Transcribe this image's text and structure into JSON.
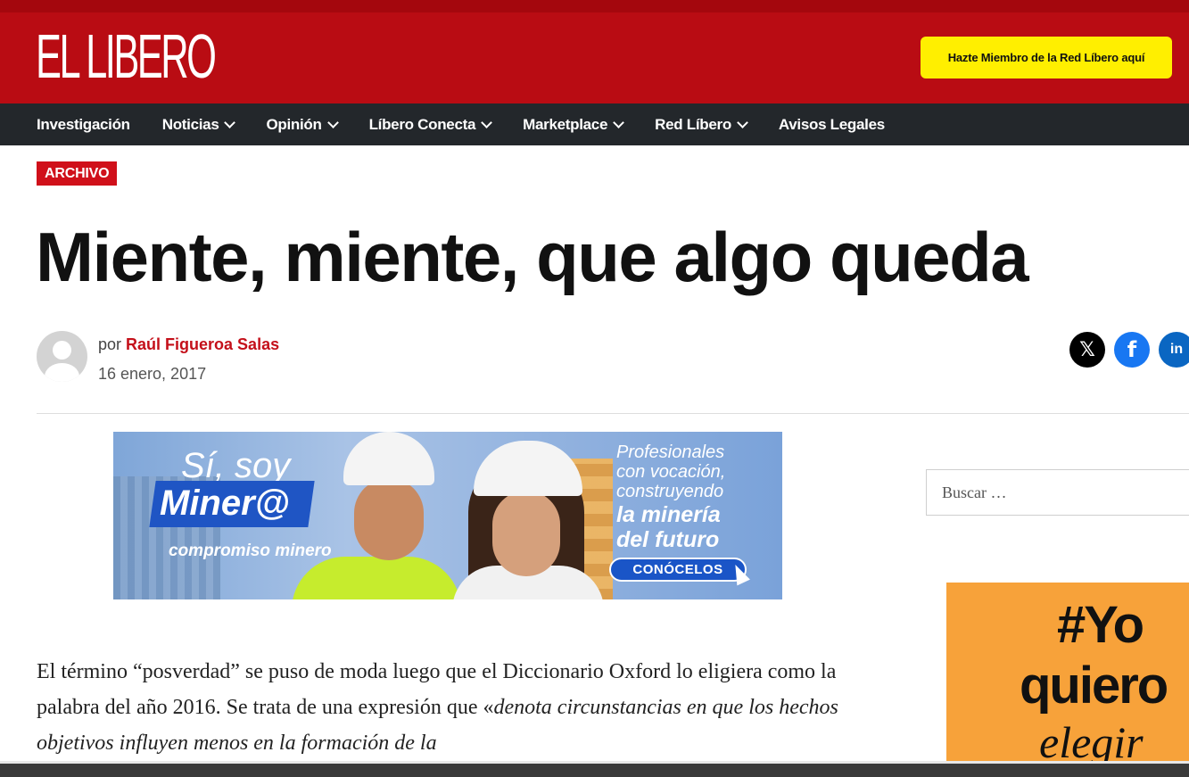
{
  "header": {
    "logo_text": "EL LIBERO",
    "member_button": "Hazte Miembro de la Red Líbero aquí",
    "brand_color": "#b90c13"
  },
  "nav": {
    "items": [
      {
        "label": "Investigación",
        "dropdown": false
      },
      {
        "label": "Noticias",
        "dropdown": true
      },
      {
        "label": "Opinión",
        "dropdown": true
      },
      {
        "label": "Líbero Conecta",
        "dropdown": true
      },
      {
        "label": "Marketplace",
        "dropdown": true
      },
      {
        "label": "Red Líbero",
        "dropdown": true
      },
      {
        "label": "Avisos Legales",
        "dropdown": false
      }
    ]
  },
  "article": {
    "category": "ARCHIVO",
    "title": "Miente, miente, que algo queda",
    "by_prefix": "por",
    "author": "Raúl Figueroa Salas",
    "date": "16 enero, 2017",
    "body_start": "El término “posverdad” se puso de moda luego que el Diccionario Oxford lo eligiera como la palabra del año 2016. Se trata de una expresión que «",
    "body_italic": "denota circunstancias en que los hechos objetivos influyen menos en la formación de la"
  },
  "share": {
    "x_icon": "x-icon",
    "facebook_icon": "facebook-icon",
    "linkedin_icon": "linkedin-icon"
  },
  "ad_banner": {
    "line1": "Sí, soy",
    "line2": "Miner@",
    "brand": "compromiso minero",
    "right_line1": "Profesionales",
    "right_line2": "con vocación,",
    "right_line3": "construyendo",
    "right_line4": "la minería",
    "right_line5": "del futuro",
    "cta": "CONÓCELOS"
  },
  "sidebar": {
    "search_placeholder": "Buscar …",
    "ad_line1": "#Yo",
    "ad_line2": "quiero",
    "ad_line3": "elegir"
  }
}
